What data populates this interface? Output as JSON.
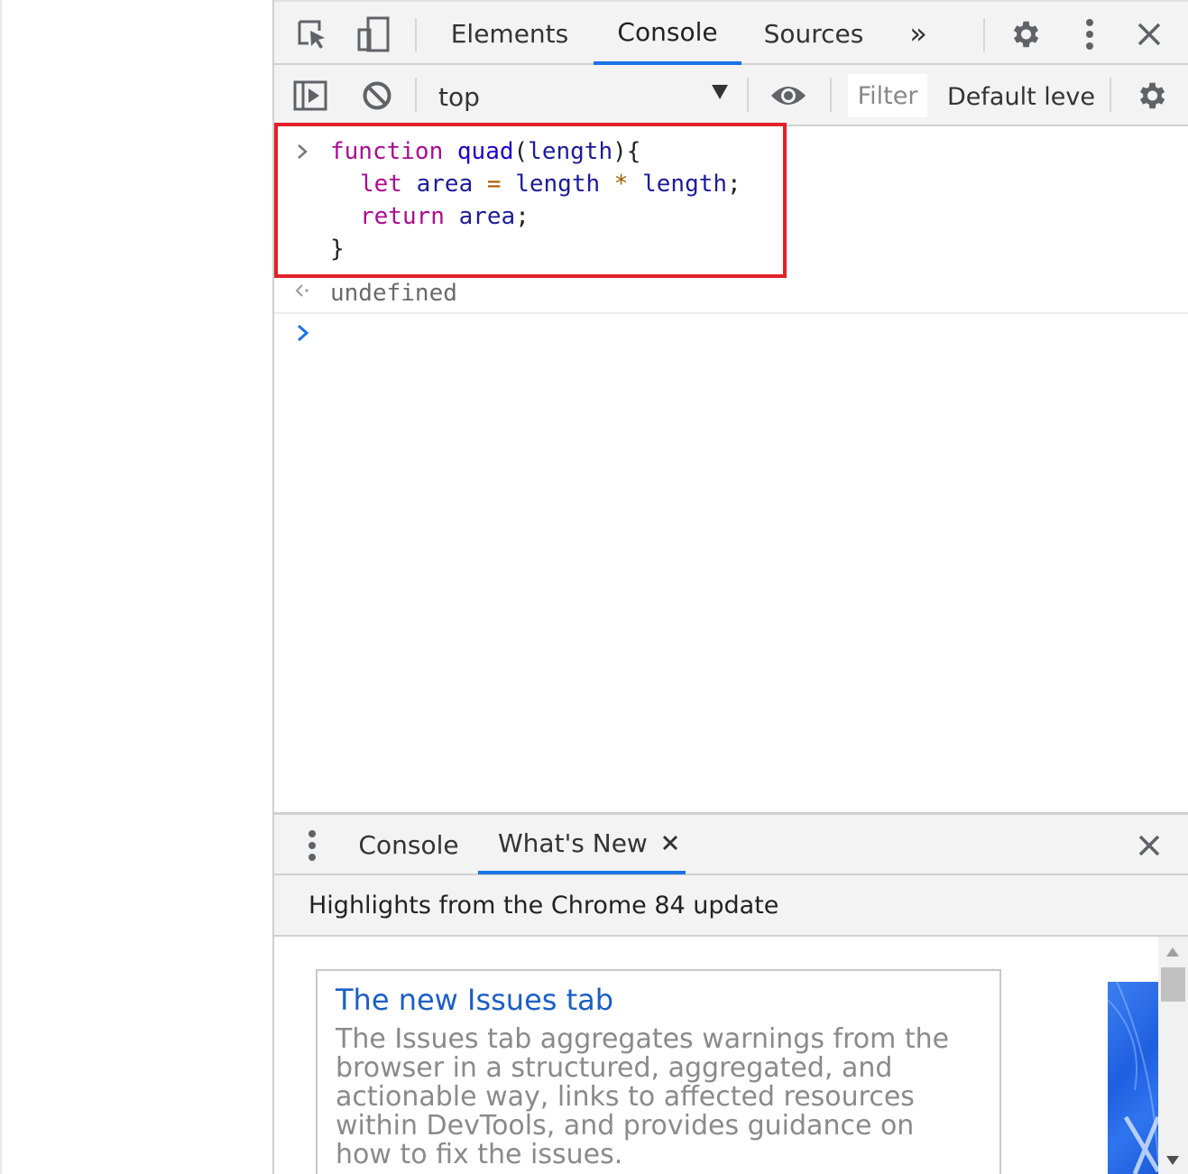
{
  "devtools": {
    "tabs": [
      {
        "label": "Elements"
      },
      {
        "label": "Console"
      },
      {
        "label": "Sources"
      }
    ],
    "more_tabs_glyph": "»",
    "active_tab": "Console"
  },
  "console_toolbar": {
    "context": "top",
    "filter_placeholder": "Filter",
    "level": "Default levels"
  },
  "console": {
    "entry": {
      "line1": {
        "kw": "function",
        "name": "quad",
        "params_open": "(",
        "param": "length",
        "params_close": "){"
      },
      "line2": {
        "kw": "let",
        "var": "area",
        "eq": "=",
        "a": "length",
        "op": "*",
        "b": "length",
        "end": ";"
      },
      "line3": {
        "kw": "return",
        "var": "area",
        "end": ";"
      },
      "line4": {
        "close": "}"
      }
    },
    "result": "undefined",
    "highlight_color": "#e3202a"
  },
  "drawer": {
    "tabs": [
      {
        "label": "Console"
      },
      {
        "label": "What's New"
      }
    ],
    "active_tab": "What's New",
    "header": "Highlights from the Chrome 84 update",
    "card": {
      "title": "The new Issues tab",
      "body": "The Issues tab aggregates warnings from the browser in a structured, aggregated, and actionable way, links to affected resources within DevTools, and provides guidance on how to fix the issues."
    }
  },
  "colors": {
    "accent": "#1a73e8",
    "link": "#1a5fc4"
  }
}
